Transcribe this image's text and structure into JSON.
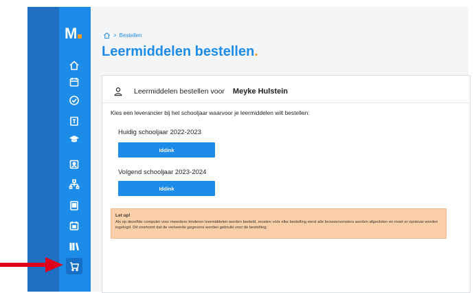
{
  "sidebar": {
    "logo": "M",
    "items": [
      {
        "icon": "home-icon"
      },
      {
        "icon": "calendar-icon"
      },
      {
        "icon": "check-circle-icon"
      },
      {
        "icon": "grades-icon"
      },
      {
        "icon": "graduation-cap-icon"
      },
      {
        "icon": "id-card-icon"
      },
      {
        "icon": "hierarchy-icon"
      },
      {
        "icon": "document-icon"
      },
      {
        "icon": "calendar-alt-icon"
      },
      {
        "icon": "books-icon"
      },
      {
        "icon": "cart-icon",
        "active": true
      }
    ]
  },
  "breadcrumb": {
    "current": "Bestellen"
  },
  "page": {
    "title": "Leermiddelen bestellen",
    "title_dot": "."
  },
  "card": {
    "header_label": "Leermiddelen bestellen voor",
    "student_name": "Meyke Hulstein",
    "intro": "Kies een leverancier bij het schooljaar waarvoor je leermiddelen wilt bestellen:",
    "years": [
      {
        "label": "Huidig schooljaar 2022-2023",
        "supplier": "Iddink"
      },
      {
        "label": "Volgend schooljaar 2023-2024",
        "supplier": "Iddink"
      }
    ],
    "notice": {
      "title": "Let op!",
      "text": "Als op dezelfde computer voor meerdere kinderen leermiddelen worden besteld, moeten vóór elke bestelling eerst alle browservensters worden afgesloten en moet er opnieuw worden ingelogd. Dit voorkomt dat de verkeerde gegevens worden gebruikt voor de bestelling."
    }
  },
  "colors": {
    "accent": "#1c8ce8",
    "brand_dot": "#ff9a1f",
    "notice_bg": "#fbd0a9",
    "arrow": "#e0001b"
  }
}
